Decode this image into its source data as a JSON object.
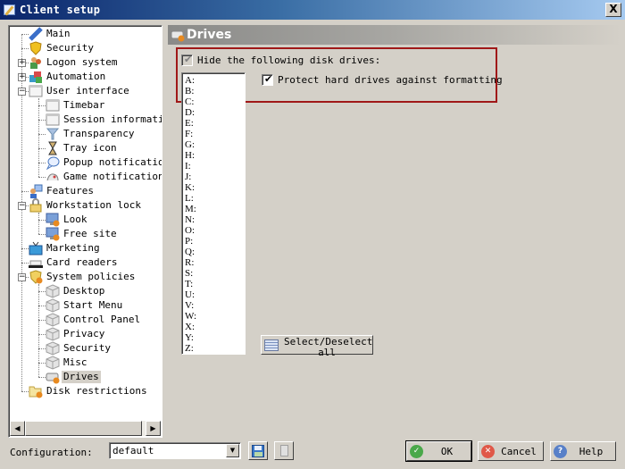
{
  "window": {
    "title": "Client setup",
    "close_label": "X"
  },
  "tree": {
    "items": [
      {
        "label": "Main",
        "icon": "satellite-icon",
        "level": 0,
        "expander": null
      },
      {
        "label": "Security",
        "icon": "shield-icon",
        "level": 0,
        "expander": null
      },
      {
        "label": "Logon system",
        "icon": "users-icon",
        "level": 0,
        "expander": "+"
      },
      {
        "label": "Automation",
        "icon": "blocks-icon",
        "level": 0,
        "expander": "+"
      },
      {
        "label": "User interface",
        "icon": "window-icon",
        "level": 0,
        "expander": "-"
      },
      {
        "label": "Timebar",
        "icon": "window-icon",
        "level": 1,
        "expander": null
      },
      {
        "label": "Session information",
        "icon": "window-icon",
        "level": 1,
        "expander": null
      },
      {
        "label": "Transparency",
        "icon": "funnel-icon",
        "level": 1,
        "expander": null
      },
      {
        "label": "Tray icon",
        "icon": "hourglass-icon",
        "level": 1,
        "expander": null
      },
      {
        "label": "Popup notification",
        "icon": "speech-bubble-icon",
        "level": 1,
        "expander": null
      },
      {
        "label": "Game notifications",
        "icon": "gamepad-icon",
        "level": 1,
        "expander": null
      },
      {
        "label": "Features",
        "icon": "user-monitor-icon",
        "level": 0,
        "expander": null
      },
      {
        "label": "Workstation lock",
        "icon": "padlock-icon",
        "level": 0,
        "expander": "-"
      },
      {
        "label": "Look",
        "icon": "monitor-icon",
        "level": 1,
        "expander": null
      },
      {
        "label": "Free site",
        "icon": "monitor-icon",
        "level": 1,
        "expander": null
      },
      {
        "label": "Marketing",
        "icon": "tv-icon",
        "level": 0,
        "expander": null
      },
      {
        "label": "Card readers",
        "icon": "card-reader-icon",
        "level": 0,
        "expander": null
      },
      {
        "label": "System policies",
        "icon": "policy-shield-icon",
        "level": 0,
        "expander": "-"
      },
      {
        "label": "Desktop",
        "icon": "cube-icon",
        "level": 1,
        "expander": null
      },
      {
        "label": "Start Menu",
        "icon": "cube-icon",
        "level": 1,
        "expander": null
      },
      {
        "label": "Control Panel",
        "icon": "cube-icon",
        "level": 1,
        "expander": null
      },
      {
        "label": "Privacy",
        "icon": "cube-icon",
        "level": 1,
        "expander": null
      },
      {
        "label": "Security",
        "icon": "cube-icon",
        "level": 1,
        "expander": null
      },
      {
        "label": "Misc",
        "icon": "cube-icon",
        "level": 1,
        "expander": null
      },
      {
        "label": "Drives",
        "icon": "drive-icon",
        "level": 1,
        "expander": null,
        "selected": true
      },
      {
        "label": "Disk restrictions",
        "icon": "folder-icon",
        "level": 0,
        "expander": null
      }
    ]
  },
  "panel": {
    "title": "Drives",
    "hide_drives": {
      "label": "Hide the following disk drives:",
      "checked": true,
      "enabled": false
    },
    "protect_drives": {
      "label": "Protect hard drives against formatting",
      "checked": true
    },
    "drives": [
      "A:",
      "B:",
      "C:",
      "D:",
      "E:",
      "F:",
      "G:",
      "H:",
      "I:",
      "J:",
      "K:",
      "L:",
      "M:",
      "N:",
      "O:",
      "P:",
      "Q:",
      "R:",
      "S:",
      "T:",
      "U:",
      "V:",
      "W:",
      "X:",
      "Y:",
      "Z:"
    ],
    "select_all_label": "Select/Deselect all"
  },
  "footer": {
    "config_label": "Configuration:",
    "config_value": "default",
    "ok_label": "OK",
    "cancel_label": "Cancel",
    "help_label": "Help"
  },
  "colors": {
    "highlight": "#a01818",
    "ok": "#4aa84a",
    "cancel": "#e05848",
    "help": "#5880c8"
  }
}
